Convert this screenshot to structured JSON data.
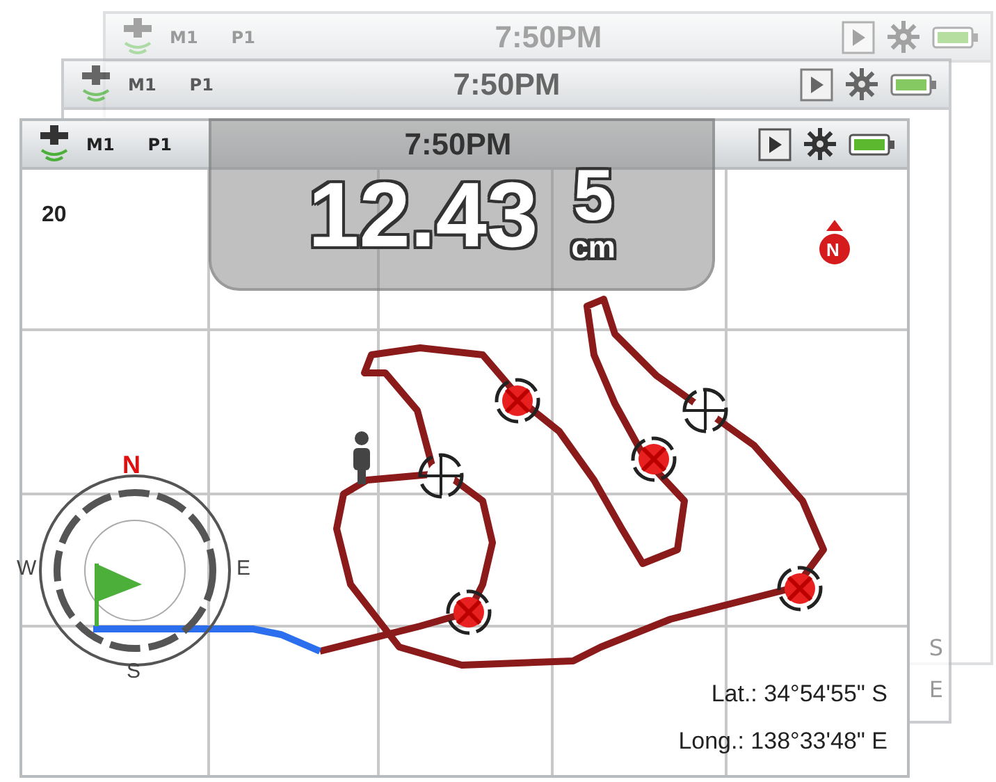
{
  "screens": [
    {
      "kind": "back",
      "mode": "M1",
      "profile": "P1",
      "time": "7:50PM"
    },
    {
      "kind": "back",
      "mode": "M1",
      "profile": "P1",
      "time": "7:50PM",
      "edge_texts": [
        "S",
        "E"
      ]
    },
    {
      "kind": "front",
      "mode": "M1",
      "profile": "P1",
      "time": "7:50PM",
      "depth": "12.43",
      "count": "5",
      "unit": "cm",
      "scale": "20",
      "north_marker": "N",
      "compass": {
        "north": "N",
        "west": "W",
        "east": "E",
        "south": "S"
      },
      "latitude": "Lat.: 34°54'55\" S",
      "longitude": "Long.: 138°33'48\" E",
      "targets": [
        {
          "kind": "found"
        },
        {
          "kind": "found"
        },
        {
          "kind": "found"
        },
        {
          "kind": "found"
        },
        {
          "kind": "marked"
        },
        {
          "kind": "marked"
        }
      ]
    }
  ]
}
